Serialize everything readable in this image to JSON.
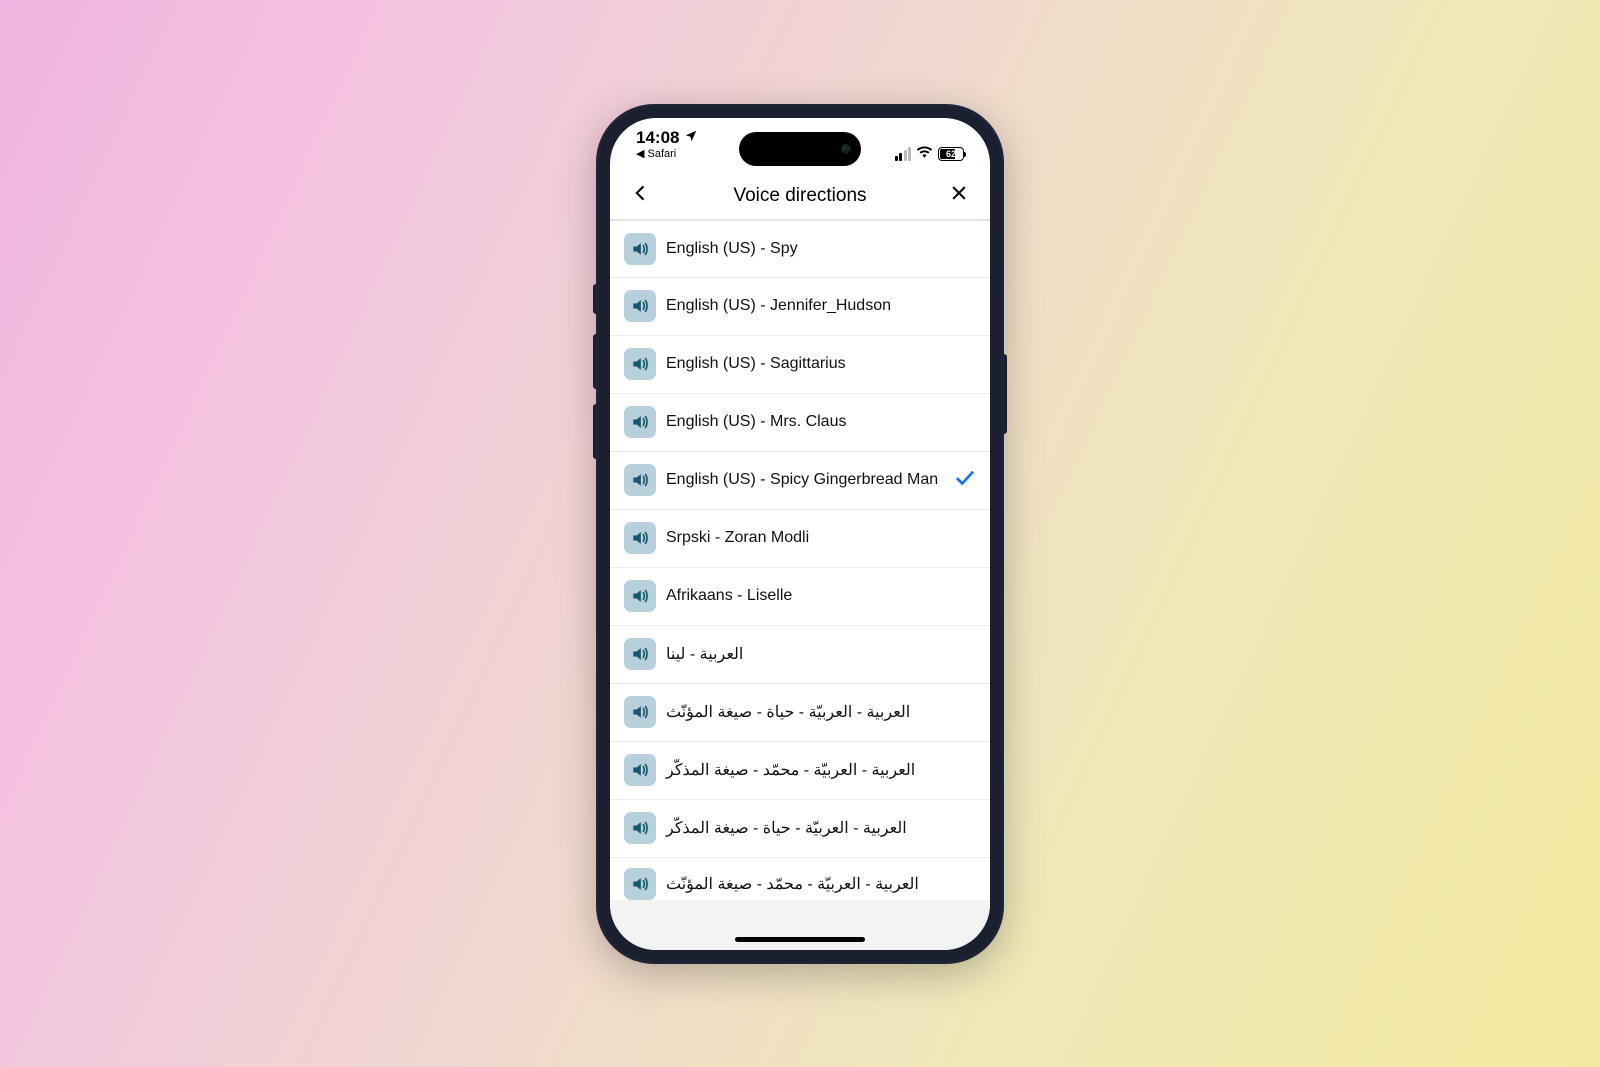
{
  "status": {
    "time": "14:08",
    "back_app": "◀ Safari",
    "battery_pct": "62"
  },
  "header": {
    "title": "Voice directions"
  },
  "voices": [
    {
      "label": "English (US) - Spy",
      "selected": false
    },
    {
      "label": "English (US) - Jennifer_Hudson",
      "selected": false
    },
    {
      "label": "English (US) - Sagittarius",
      "selected": false
    },
    {
      "label": "English (US) - Mrs. Claus",
      "selected": false
    },
    {
      "label": "English (US) - Spicy Gingerbread Man",
      "selected": true
    },
    {
      "label": "Srpski - Zoran Modli",
      "selected": false
    },
    {
      "label": "Afrikaans - Liselle",
      "selected": false
    },
    {
      "label": "العربية - لينا",
      "selected": false
    },
    {
      "label": "العربية - العربيّة - حياة - صيغة المؤنّث",
      "selected": false
    },
    {
      "label": "العربية - العربيّة - محمّد - صيغة المذكّر",
      "selected": false
    },
    {
      "label": "العربية - العربيّة - حياة - صيغة المذكّر",
      "selected": false
    },
    {
      "label": "العربية -  العربيّة - محمّد - صيغة المؤنّث",
      "selected": false
    }
  ]
}
